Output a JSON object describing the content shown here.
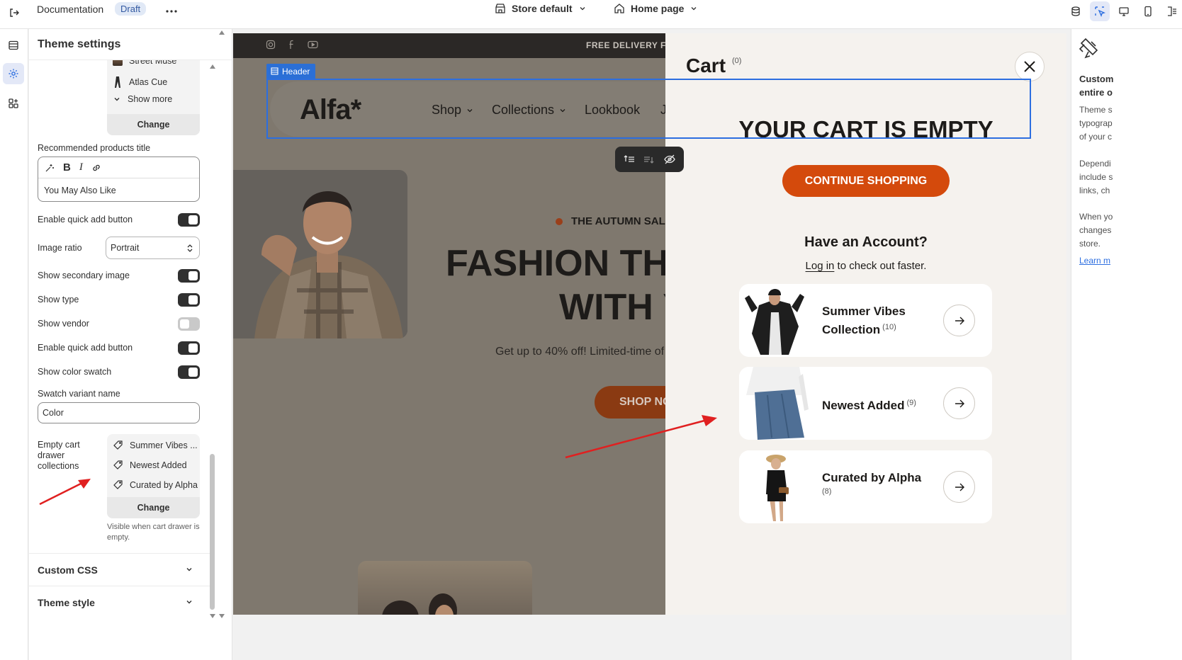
{
  "topbar": {
    "doc_title": "Documentation",
    "status_badge": "Draft",
    "store_selector": "Store default",
    "page_selector": "Home page"
  },
  "theme_settings": {
    "title": "Theme settings",
    "vendor_items": [
      "Street Muse",
      "Atlas Cue"
    ],
    "show_more": "Show more",
    "change_label": "Change",
    "recommended_title_label": "Recommended products title",
    "recommended_title_value": "You May Also Like",
    "enable_quick_add_1": "Enable quick add button",
    "image_ratio_label": "Image ratio",
    "image_ratio_value": "Portrait",
    "show_secondary_image": "Show secondary image",
    "show_type": "Show type",
    "show_vendor": "Show vendor",
    "enable_quick_add_2": "Enable quick add button",
    "show_color_swatch": "Show color swatch",
    "swatch_variant_label": "Swatch variant name",
    "swatch_variant_value": "Color",
    "empty_cart_label": "Empty cart drawer collections",
    "empty_cart_items": [
      "Summer Vibes ...",
      "Newest Added",
      "Curated by Alpha"
    ],
    "empty_cart_change": "Change",
    "empty_cart_help": "Visible when cart drawer is empty.",
    "custom_css": "Custom CSS",
    "theme_style": "Theme style",
    "toggles": {
      "enable_quick_add_1": true,
      "show_secondary_image": true,
      "show_type": true,
      "show_vendor": false,
      "enable_quick_add_2": true,
      "show_color_swatch": true
    }
  },
  "preview": {
    "announcement": "FREE DELIVERY FRO",
    "header_tag": "Header",
    "logo": "Alfa*",
    "nav": [
      "Shop",
      "Collections",
      "Lookbook",
      "J"
    ],
    "hero_tag": "THE AUTUMN SAL",
    "hero_line1": "FASHION TH",
    "hero_line2": "WITH Y",
    "hero_sub": "Get up to 40% off! Limited-time of",
    "hero_btn": "SHOP NO"
  },
  "cart": {
    "title": "Cart",
    "count": "(0)",
    "empty_title": "YOUR CART IS EMPTY",
    "cta": "CONTINUE SHOPPING",
    "account_title": "Have an Account?",
    "login_link": "Log in",
    "login_rest": " to check out faster.",
    "collections": [
      {
        "line1": "Summer Vibes",
        "line2": "Collection",
        "count": "(10)"
      },
      {
        "line1": "Newest Added",
        "count": "(9)"
      },
      {
        "line1": "Curated by Alpha",
        "count": "(8)"
      }
    ]
  },
  "right_panel": {
    "title_1": "Custom",
    "title_2": "entire o",
    "p1": [
      "Theme s",
      "typograp",
      "of your c"
    ],
    "p2": [
      "Dependi",
      "include s",
      "links, ch"
    ],
    "p3": [
      "When yo",
      "changes",
      "store."
    ],
    "link": "Learn m"
  },
  "colors": {
    "accent_blue": "#2c6ee0",
    "cart_cta": "#d44a0c",
    "annotation_arrow": "#e02020"
  }
}
